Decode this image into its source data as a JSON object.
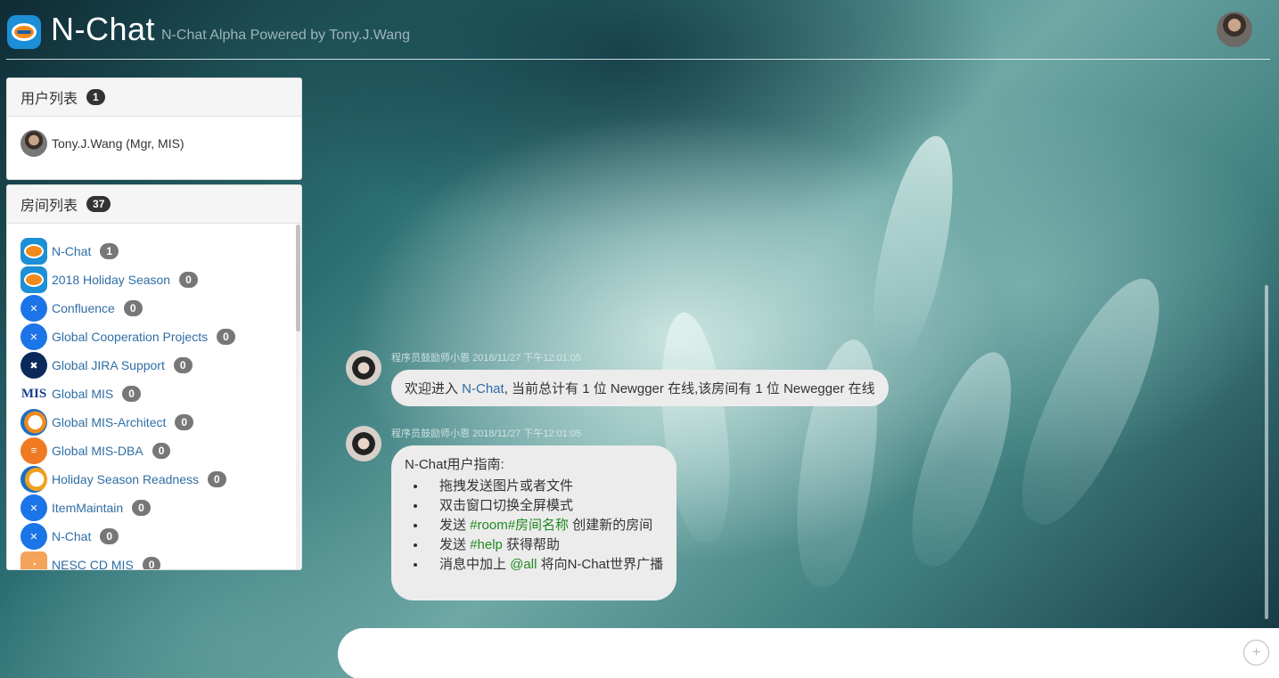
{
  "header": {
    "title": "N-Chat",
    "subtitle": "N-Chat Alpha Powered by Tony.J.Wang",
    "logo_icon": "n-chat-logo-icon",
    "avatar_icon": "user-avatar-icon"
  },
  "users_panel": {
    "title": "用户列表",
    "count": "1",
    "users": [
      {
        "name": "Tony.J.Wang (Mgr, MIS)"
      }
    ]
  },
  "rooms_panel": {
    "title": "房间列表",
    "count": "37",
    "rooms": [
      {
        "name": "N-Chat",
        "count": "1",
        "icon": "n-chat-logo-icon"
      },
      {
        "name": "2018 Holiday Season",
        "count": "0",
        "icon": "n-chat-logo-icon"
      },
      {
        "name": "Confluence",
        "count": "0",
        "icon": "confluence-icon"
      },
      {
        "name": "Global Cooperation Projects",
        "count": "0",
        "icon": "confluence-icon"
      },
      {
        "name": "Global JIRA Support",
        "count": "0",
        "icon": "jira-icon"
      },
      {
        "name": "Global MIS",
        "count": "0",
        "icon": "mis-icon"
      },
      {
        "name": "Global MIS-Architect",
        "count": "0",
        "icon": "architect-icon"
      },
      {
        "name": "Global MIS-DBA",
        "count": "0",
        "icon": "database-icon"
      },
      {
        "name": "Holiday Season Readness",
        "count": "0",
        "icon": "ship-icon"
      },
      {
        "name": "ItemMaintain",
        "count": "0",
        "icon": "confluence-icon"
      },
      {
        "name": "N-Chat",
        "count": "0",
        "icon": "confluence-icon"
      },
      {
        "name": "NESC CD MIS",
        "count": "0",
        "icon": "rss-icon"
      }
    ]
  },
  "messages": [
    {
      "sender": "程序员鼓励师小恩",
      "time": "2018/11/27 下午12:01:05",
      "text_before": "欢迎进入 ",
      "room_link": "N-Chat",
      "text_after": ", 当前总计有 1 位 Newgger 在线,该房间有 1 位 Newegger 在线"
    },
    {
      "sender": "程序员鼓励师小恩",
      "time": "2018/11/27 下午12:01:05",
      "guide_title": "N-Chat用户指南:",
      "items": [
        {
          "before": "拖拽发送图片或者文件",
          "highlight": "",
          "after": ""
        },
        {
          "before": "双击窗口切换全屏模式",
          "highlight": "",
          "after": ""
        },
        {
          "before": "发送 ",
          "highlight": "#room#房间名称",
          "after": " 创建新的房间"
        },
        {
          "before": "发送 ",
          "highlight": "#help",
          "after": " 获得帮助"
        },
        {
          "before": "消息中加上 ",
          "highlight": "@all",
          "after": " 将向N-Chat世界广播"
        }
      ]
    }
  ],
  "composer": {
    "placeholder": "",
    "send_icon": "plus-icon"
  },
  "colors": {
    "link": "#2f6ea5",
    "highlight": "#1f8a1f",
    "bubble": "#ececec"
  }
}
